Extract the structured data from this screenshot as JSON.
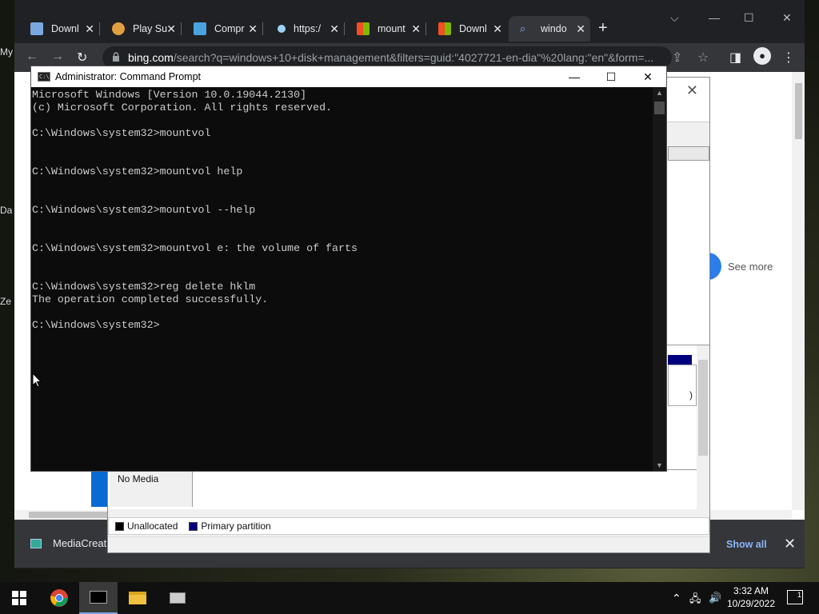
{
  "desktop": {
    "icons": [
      "My",
      "Da",
      "Ze"
    ]
  },
  "chrome": {
    "tabs": [
      {
        "label": "Downl",
        "favicon": "network-icon",
        "color": "#7aa7e0"
      },
      {
        "label": "Play Su",
        "favicon": "person-icon",
        "color": "#e0a040"
      },
      {
        "label": "Compr",
        "favicon": "map-pin-icon",
        "color": "#4aa3df"
      },
      {
        "label": "https:/",
        "favicon": "globe-icon",
        "color": "#9cd3f5"
      },
      {
        "label": "mount",
        "favicon": "microsoft-icon",
        "color": "#f25022"
      },
      {
        "label": "Downl",
        "favicon": "microsoft-icon",
        "color": "#f25022"
      },
      {
        "label": "windo",
        "favicon": "search-icon",
        "color": "#4aa3df",
        "active": true
      }
    ],
    "url_host": "bing.com",
    "url_rest": "/search?q=windows+10+disk+management&filters=guid:\"4027721-en-dia\"%20lang:\"en\"&form=...",
    "see_more": "See more",
    "download_name": "MediaCreati",
    "show_all": "Show all"
  },
  "diskmgmt": {
    "partition_tail": ")",
    "no_media": "No Media",
    "legend": [
      {
        "label": "Unallocated",
        "color": "#000000"
      },
      {
        "label": "Primary partition",
        "color": "#00007c"
      }
    ]
  },
  "cmd": {
    "title": "Administrator: Command Prompt",
    "icon_text": "C:\\",
    "lines": [
      "Microsoft Windows [Version 10.0.19044.2130]",
      "(c) Microsoft Corporation. All rights reserved.",
      "",
      "C:\\Windows\\system32>mountvol",
      "",
      "",
      "C:\\Windows\\system32>mountvol help",
      "",
      "",
      "C:\\Windows\\system32>mountvol --help",
      "",
      "",
      "C:\\Windows\\system32>mountvol e: the volume of farts",
      "",
      "",
      "C:\\Windows\\system32>reg delete hklm",
      "The operation completed successfully.",
      "",
      "C:\\Windows\\system32>"
    ]
  },
  "taskbar": {
    "time": "3:32 AM",
    "date": "10/29/2022",
    "notification_count": "1"
  }
}
